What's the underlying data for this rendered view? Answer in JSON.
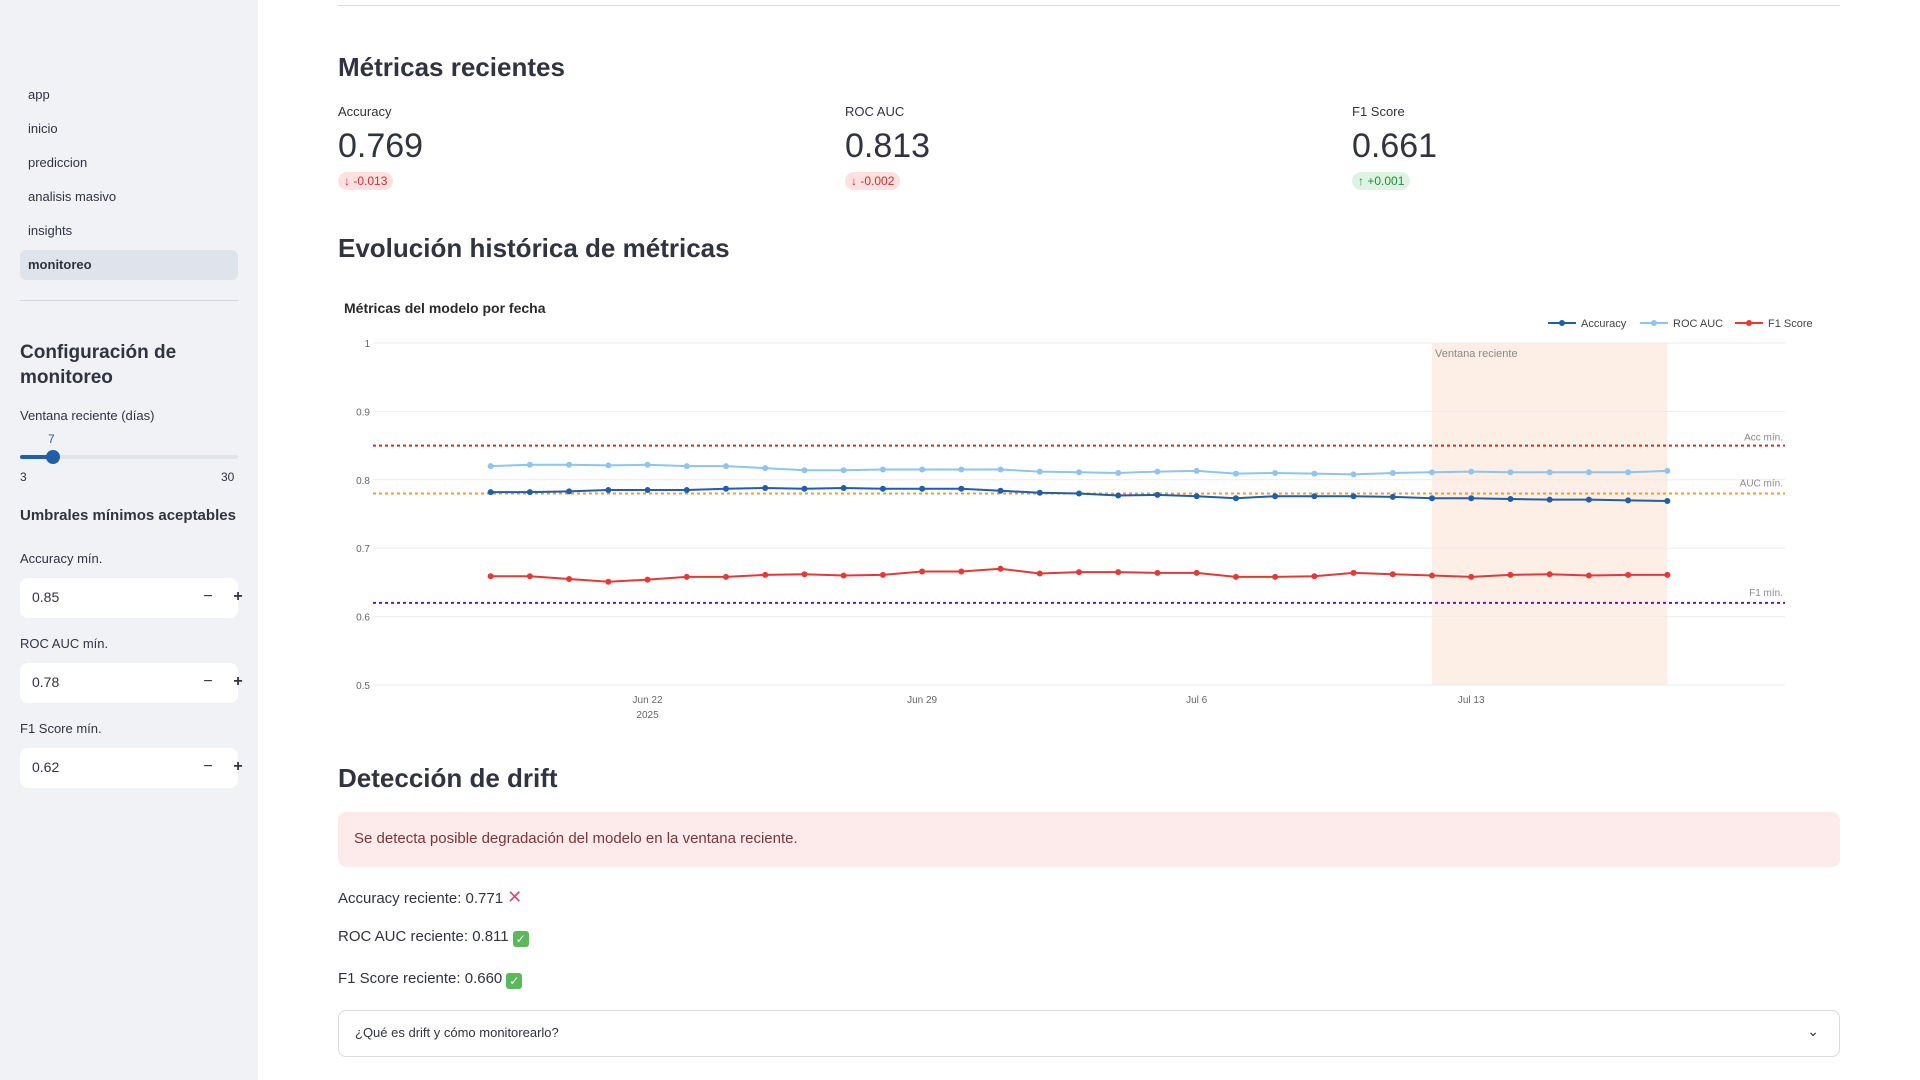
{
  "sidebar": {
    "nav": [
      {
        "label": "app",
        "active": false
      },
      {
        "label": "inicio",
        "active": false
      },
      {
        "label": "prediccion",
        "active": false
      },
      {
        "label": "analisis masivo",
        "active": false
      },
      {
        "label": "insights",
        "active": false
      },
      {
        "label": "monitoreo",
        "active": true
      }
    ],
    "config_title": "Configuración de monitoreo",
    "window_label": "Ventana reciente (días)",
    "window_value": "7",
    "window_min": "3",
    "window_max": "30",
    "thresholds_title": "Umbrales mínimos aceptables",
    "acc_label": "Accuracy mín.",
    "acc_value": "0.85",
    "auc_label": "ROC AUC mín.",
    "auc_value": "0.78",
    "f1_label": "F1 Score mín.",
    "f1_value": "0.62",
    "minus": "−",
    "plus": "+"
  },
  "main": {
    "recent_title": "Métricas recientes",
    "metrics": [
      {
        "label": "Accuracy",
        "value": "0.769",
        "delta": "-0.013",
        "direction": "down"
      },
      {
        "label": "ROC AUC",
        "value": "0.813",
        "delta": "-0.002",
        "direction": "down"
      },
      {
        "label": "F1 Score",
        "value": "0.661",
        "delta": "+0.001",
        "direction": "up"
      }
    ],
    "history_title": "Evolución histórica de métricas",
    "drift_title": "Detección de drift",
    "drift_alert": "Se detecta posible degradación del modelo en la ventana reciente.",
    "acc_recent": "Accuracy reciente: 0.771",
    "auc_recent": "ROC AUC reciente: 0.811",
    "f1_recent": "F1 Score reciente: 0.660",
    "expander_label": "¿Qué es drift y cómo monitorearlo?"
  },
  "chart_data": {
    "type": "line",
    "title": "Métricas del modelo por fecha",
    "x_ticks": [
      "Jun 22",
      "Jun 29",
      "Jul 6",
      "Jul 13"
    ],
    "x_tick_year": "2025",
    "y_ticks": [
      "0.5",
      "0.6",
      "0.7",
      "0.8",
      "0.9",
      "1"
    ],
    "ylim": [
      0.5,
      1.0
    ],
    "x": [
      "2025-06-18",
      "2025-06-19",
      "2025-06-20",
      "2025-06-21",
      "2025-06-22",
      "2025-06-23",
      "2025-06-24",
      "2025-06-25",
      "2025-06-26",
      "2025-06-27",
      "2025-06-28",
      "2025-06-29",
      "2025-06-30",
      "2025-07-01",
      "2025-07-02",
      "2025-07-03",
      "2025-07-04",
      "2025-07-05",
      "2025-07-06",
      "2025-07-07",
      "2025-07-08",
      "2025-07-09",
      "2025-07-10",
      "2025-07-11",
      "2025-07-12",
      "2025-07-13",
      "2025-07-14",
      "2025-07-15",
      "2025-07-16",
      "2025-07-17",
      "2025-07-18"
    ],
    "series": [
      {
        "name": "Accuracy",
        "color": "#1f5fa8",
        "values": [
          0.782,
          0.782,
          0.783,
          0.785,
          0.785,
          0.785,
          0.787,
          0.788,
          0.787,
          0.788,
          0.787,
          0.787,
          0.787,
          0.784,
          0.781,
          0.78,
          0.777,
          0.778,
          0.776,
          0.773,
          0.776,
          0.776,
          0.776,
          0.775,
          0.773,
          0.773,
          0.772,
          0.771,
          0.771,
          0.77,
          0.769
        ]
      },
      {
        "name": "ROC AUC",
        "color": "#8ec4ef",
        "values": [
          0.82,
          0.822,
          0.822,
          0.821,
          0.822,
          0.82,
          0.82,
          0.817,
          0.814,
          0.814,
          0.815,
          0.815,
          0.815,
          0.815,
          0.812,
          0.811,
          0.81,
          0.812,
          0.813,
          0.809,
          0.81,
          0.809,
          0.808,
          0.81,
          0.811,
          0.812,
          0.811,
          0.811,
          0.811,
          0.811,
          0.813
        ]
      },
      {
        "name": "F1 Score",
        "color": "#e53935",
        "values": [
          0.659,
          0.659,
          0.655,
          0.651,
          0.654,
          0.658,
          0.658,
          0.661,
          0.662,
          0.66,
          0.661,
          0.666,
          0.666,
          0.67,
          0.663,
          0.665,
          0.665,
          0.664,
          0.664,
          0.658,
          0.658,
          0.659,
          0.664,
          0.662,
          0.66,
          0.658,
          0.661,
          0.662,
          0.66,
          0.661,
          0.661
        ]
      }
    ],
    "thresholds": [
      {
        "label": "Acc mín.",
        "value": 0.85,
        "color": "#d62728"
      },
      {
        "label": "AUC mín.",
        "value": 0.78,
        "color": "#f0a020"
      },
      {
        "label": "F1 mín.",
        "value": 0.62,
        "color": "#6a1b9a"
      }
    ],
    "recent_window": {
      "label": "Ventana reciente",
      "start": "2025-07-12",
      "end": "2025-07-18"
    },
    "legend_position": "top-right",
    "grid": true
  }
}
